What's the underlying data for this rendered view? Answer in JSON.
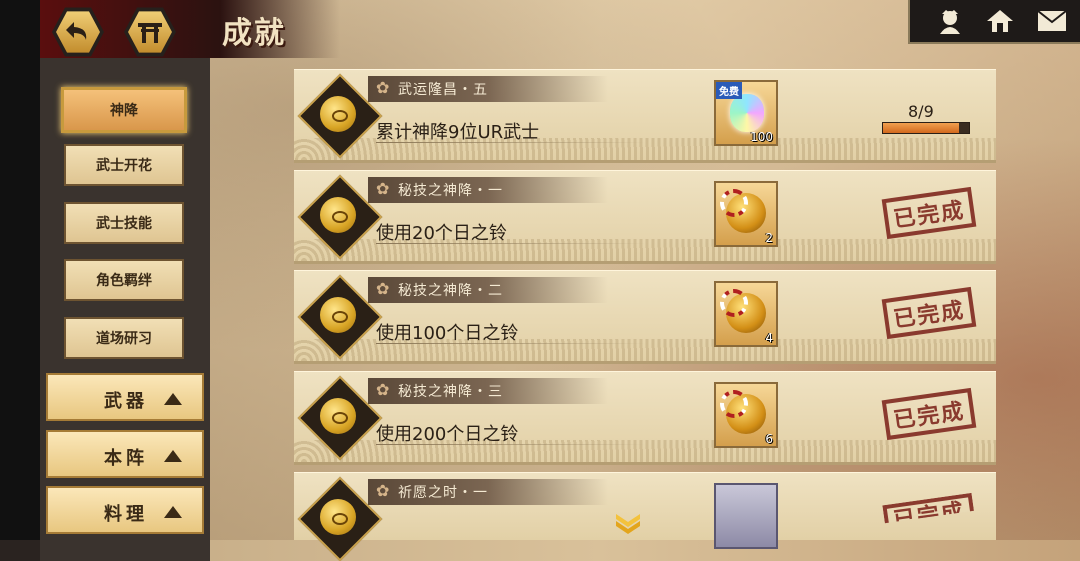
{
  "header": {
    "title": "成就",
    "back_icon": "back-arrow-icon",
    "home_icon": "torii-gate-icon"
  },
  "top_right": {
    "icons": [
      "character-icon",
      "home-icon",
      "mail-icon"
    ]
  },
  "sidebar": {
    "sub_items": [
      {
        "label": "神降",
        "active": true
      },
      {
        "label": "武士开花",
        "active": false
      },
      {
        "label": "武士技能",
        "active": false
      },
      {
        "label": "角色羁绊",
        "active": false
      },
      {
        "label": "道场研习",
        "active": false
      }
    ],
    "categories": [
      {
        "label": "武器"
      },
      {
        "label": "本阵"
      },
      {
        "label": "料理"
      }
    ]
  },
  "achievements": [
    {
      "name": "武运隆昌・五",
      "desc": "累计神降9位UR武士",
      "reward": {
        "type": "crystal",
        "free_label": "免费",
        "count": "100"
      },
      "progress": {
        "text": "8/9",
        "value": 8,
        "max": 9
      },
      "completed": false
    },
    {
      "name": "秘技之神降・一",
      "desc": "使用20个日之铃",
      "reward": {
        "type": "bell",
        "count": "2"
      },
      "stamp": "已完成",
      "completed": true
    },
    {
      "name": "秘技之神降・二",
      "desc": "使用100个日之铃",
      "reward": {
        "type": "bell",
        "count": "4"
      },
      "stamp": "已完成",
      "completed": true
    },
    {
      "name": "秘技之神降・三",
      "desc": "使用200个日之铃",
      "reward": {
        "type": "bell",
        "count": "6"
      },
      "stamp": "已完成",
      "completed": true
    },
    {
      "name": "祈愿之时・一",
      "desc": "",
      "reward": {
        "type": "other",
        "count": ""
      },
      "stamp": "已完成",
      "completed": true
    }
  ],
  "colors": {
    "accent": "#d9974b",
    "progress": "#d2691e",
    "stamp": "#8a3a2e"
  }
}
